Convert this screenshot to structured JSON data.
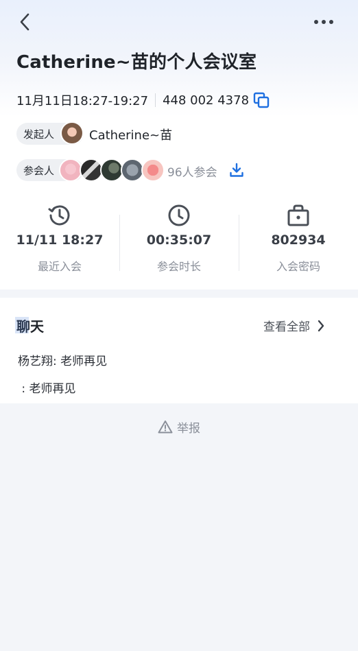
{
  "header": {
    "back_icon": "chevron-left-icon",
    "more_icon": "more-dots-icon"
  },
  "meeting": {
    "title": "Catherine~苗的个人会议室",
    "time_range": "11月11日18:27-19:27",
    "meeting_id": "448 002 4378",
    "copy_icon": "copy-icon"
  },
  "host": {
    "label": "发起人",
    "name": "Catherine~苗"
  },
  "participants": {
    "label": "参会人",
    "count_text": "96人参会",
    "download_icon": "download-icon"
  },
  "stats": [
    {
      "icon": "history-clock-icon",
      "value": "11/11 18:27",
      "label": "最近入会"
    },
    {
      "icon": "clock-icon",
      "value": "00:35:07",
      "label": "参会时长"
    },
    {
      "icon": "lock-bag-icon",
      "value": "802934",
      "label": "入会密码"
    }
  ],
  "chat": {
    "title": "聊天",
    "view_all": "查看全部",
    "messages": [
      {
        "sender": "杨艺翔",
        "text": "老师再见"
      },
      {
        "sender": "",
        "text": "老师再见"
      }
    ]
  },
  "report": {
    "label": "举报",
    "icon": "warning-icon"
  },
  "colors": {
    "accent": "#1e6fe0",
    "muted": "#8a8f99",
    "text": "#1f2329"
  }
}
